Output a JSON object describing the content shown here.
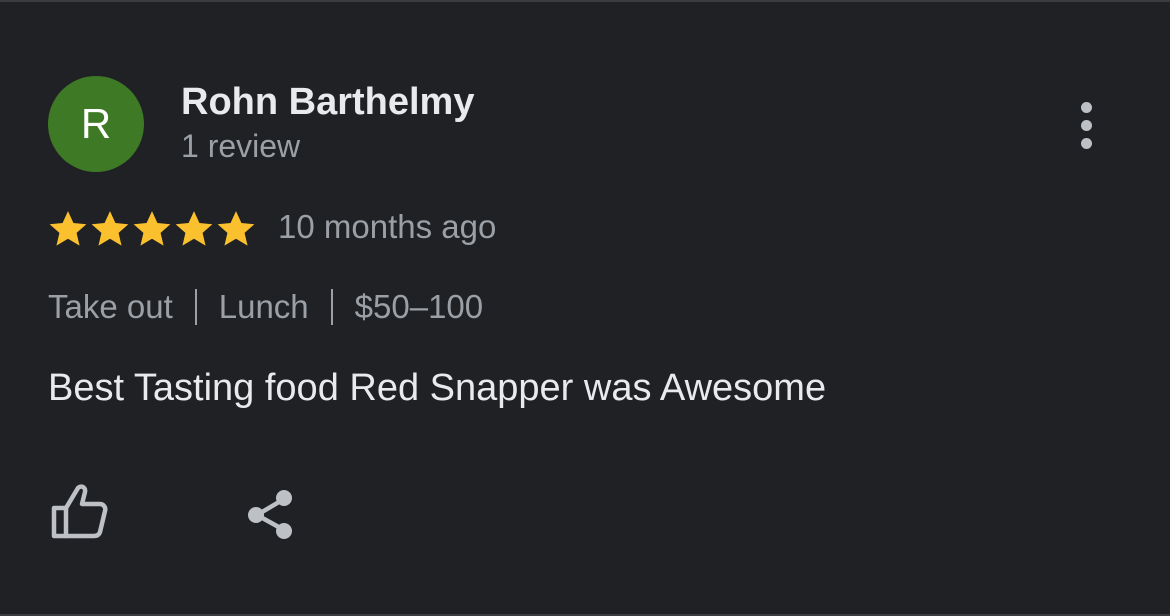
{
  "review": {
    "avatar_initial": "R",
    "avatar_color": "#3e7a25",
    "author_name": "Rohn Barthelmy",
    "review_count": "1 review",
    "rating": 5,
    "rating_max": 5,
    "star_color": "#fbc02d",
    "time_ago": "10 months ago",
    "meta": [
      "Take out",
      "Lunch",
      "$50–100"
    ],
    "text": "Best Tasting food Red Snapper was Awesome"
  },
  "icons": {
    "more": "more-vert-icon",
    "like": "thumb-up-icon",
    "share": "share-icon"
  },
  "colors": {
    "background": "#202124",
    "primary_text": "#e8eaed",
    "secondary_text": "#9aa0a6"
  }
}
